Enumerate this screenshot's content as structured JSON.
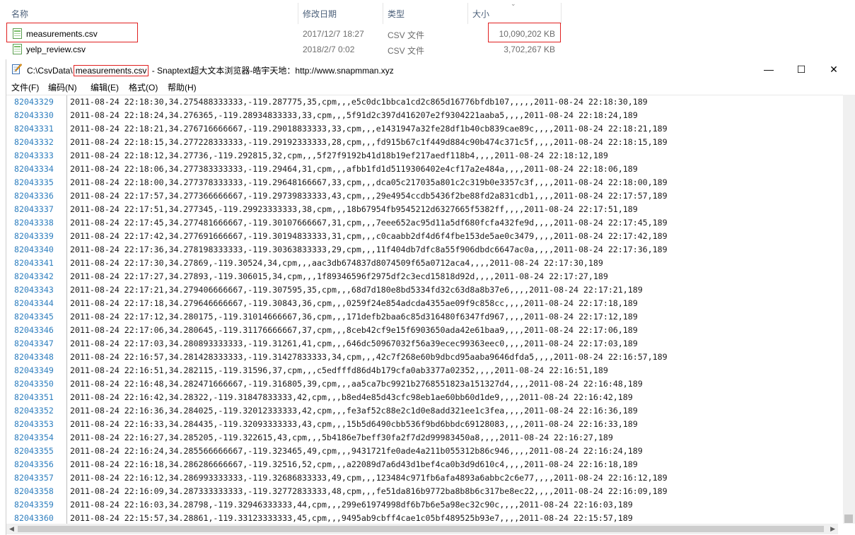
{
  "explorer": {
    "columns": {
      "name": "名称",
      "modified": "修改日期",
      "type": "类型",
      "size": "大小"
    },
    "files": [
      {
        "name": "measurements.csv",
        "modified": "2017/12/7 18:27",
        "type": "CSV 文件",
        "size": "10,090,202 KB"
      },
      {
        "name": "yelp_review.csv",
        "modified": "2018/2/7 0:02",
        "type": "CSV 文件",
        "size": "3,702,267 KB"
      }
    ]
  },
  "window": {
    "title_prefix": "C:\\CsvData\\",
    "title_file": "measurements.csv",
    "title_suffix": " - Snaptext超大文本浏览器-皓宇天地：http://www.snapmman.xyz",
    "buttons": {
      "minimize": "—",
      "maximize": "☐",
      "close": "✕"
    }
  },
  "menu": [
    "文件(F)",
    "编码(N)",
    "编辑(E)",
    "格式(O)",
    "帮助(H)"
  ],
  "lines": [
    {
      "n": "82043329",
      "t": "2011-08-24 22:18:30,34.275488333333,-119.287775,35,cpm,,,e5c0dc1bbca1cd2c865d16776bfdb107,,,,,2011-08-24 22:18:30,189"
    },
    {
      "n": "82043330",
      "t": "2011-08-24 22:18:24,34.276365,-119.28934833333,33,cpm,,,5f91d2c397d416207e2f9304221aaba5,,,,2011-08-24 22:18:24,189"
    },
    {
      "n": "82043331",
      "t": "2011-08-24 22:18:21,34.276716666667,-119.29018833333,33,cpm,,,e1431947a32fe28df1b40cb839cae89c,,,,2011-08-24 22:18:21,189"
    },
    {
      "n": "82043332",
      "t": "2011-08-24 22:18:15,34.277228333333,-119.29192333333,28,cpm,,,fd915b67c1f449d884c90b474c371c5f,,,,2011-08-24 22:18:15,189"
    },
    {
      "n": "82043333",
      "t": "2011-08-24 22:18:12,34.27736,-119.292815,32,cpm,,,5f27f9192b41d18b19ef217aedf118b4,,,,2011-08-24 22:18:12,189"
    },
    {
      "n": "82043334",
      "t": "2011-08-24 22:18:06,34.277383333333,-119.29464,31,cpm,,,afbb1fd1d5119306402e4cf17a2e484a,,,,2011-08-24 22:18:06,189"
    },
    {
      "n": "82043335",
      "t": "2011-08-24 22:18:00,34.277378333333,-119.29648166667,33,cpm,,,dca05c217035a801c2c319b0e3357c3f,,,,2011-08-24 22:18:00,189"
    },
    {
      "n": "82043336",
      "t": "2011-08-24 22:17:57,34.277366666667,-119.29739833333,43,cpm,,,29e4954ccdb5436f2be88fd2a831cdb1,,,,2011-08-24 22:17:57,189"
    },
    {
      "n": "82043337",
      "t": "2011-08-24 22:17:51,34.277345,-119.29923333333,38,cpm,,,18b67954fb9545212d6327665f5382ff,,,,2011-08-24 22:17:51,189"
    },
    {
      "n": "82043338",
      "t": "2011-08-24 22:17:45,34.277481666667,-119.30107666667,31,cpm,,,7eee652ac95d11a5df680fcfa432fe9d,,,,2011-08-24 22:17:45,189"
    },
    {
      "n": "82043339",
      "t": "2011-08-24 22:17:42,34.277691666667,-119.30194833333,31,cpm,,,c0caabb2df4d6f4fbe153de5ae0c3479,,,,2011-08-24 22:17:42,189"
    },
    {
      "n": "82043340",
      "t": "2011-08-24 22:17:36,34.278198333333,-119.30363833333,29,cpm,,,11f404db7dfc8a55f906dbdc6647ac0a,,,,2011-08-24 22:17:36,189"
    },
    {
      "n": "82043341",
      "t": "2011-08-24 22:17:30,34.27869,-119.30524,34,cpm,,,aac3db674837d8074509f65a0712aca4,,,,2011-08-24 22:17:30,189"
    },
    {
      "n": "82043342",
      "t": "2011-08-24 22:17:27,34.27893,-119.306015,34,cpm,,,1f89346596f2975df2c3ecd15818d92d,,,,2011-08-24 22:17:27,189"
    },
    {
      "n": "82043343",
      "t": "2011-08-24 22:17:21,34.279406666667,-119.307595,35,cpm,,,68d7d180e8bd5334fd32c63d8a8b37e6,,,,2011-08-24 22:17:21,189"
    },
    {
      "n": "82043344",
      "t": "2011-08-24 22:17:18,34.279646666667,-119.30843,36,cpm,,,0259f24e854adcda4355ae09f9c858cc,,,,2011-08-24 22:17:18,189"
    },
    {
      "n": "82043345",
      "t": "2011-08-24 22:17:12,34.280175,-119.31014666667,36,cpm,,,171defb2baa6c85d316480f6347fd967,,,,2011-08-24 22:17:12,189"
    },
    {
      "n": "82043346",
      "t": "2011-08-24 22:17:06,34.280645,-119.31176666667,37,cpm,,,8ceb42cf9e15f6903650ada42e61baa9,,,,2011-08-24 22:17:06,189"
    },
    {
      "n": "82043347",
      "t": "2011-08-24 22:17:03,34.280893333333,-119.31261,41,cpm,,,646dc50967032f56a39ecec99363eec0,,,,2011-08-24 22:17:03,189"
    },
    {
      "n": "82043348",
      "t": "2011-08-24 22:16:57,34.281428333333,-119.31427833333,34,cpm,,,42c7f268e60b9dbcd95aaba9646dfda5,,,,2011-08-24 22:16:57,189"
    },
    {
      "n": "82043349",
      "t": "2011-08-24 22:16:51,34.282115,-119.31596,37,cpm,,,c5edfffd86d4b179cfa0ab3377a02352,,,,2011-08-24 22:16:51,189"
    },
    {
      "n": "82043350",
      "t": "2011-08-24 22:16:48,34.282471666667,-119.316805,39,cpm,,,aa5ca7bc9921b2768551823a151327d4,,,,2011-08-24 22:16:48,189"
    },
    {
      "n": "82043351",
      "t": "2011-08-24 22:16:42,34.28322,-119.31847833333,42,cpm,,,b8ed4e85d43cfc98eb1ae60bb60d1de9,,,,2011-08-24 22:16:42,189"
    },
    {
      "n": "82043352",
      "t": "2011-08-24 22:16:36,34.284025,-119.32012333333,42,cpm,,,fe3af52c88e2c1d0e8add321ee1c3fea,,,,2011-08-24 22:16:36,189"
    },
    {
      "n": "82043353",
      "t": "2011-08-24 22:16:33,34.284435,-119.32093333333,43,cpm,,,15b5d6490cbb536f9bd6bbdc69128083,,,,2011-08-24 22:16:33,189"
    },
    {
      "n": "82043354",
      "t": "2011-08-24 22:16:27,34.285205,-119.322615,43,cpm,,,5b4186e7beff30fa2f7d2d99983450a8,,,,2011-08-24 22:16:27,189"
    },
    {
      "n": "82043355",
      "t": "2011-08-24 22:16:24,34.285566666667,-119.323465,49,cpm,,,9431721fe0ade4a211b055312b86c946,,,,2011-08-24 22:16:24,189"
    },
    {
      "n": "82043356",
      "t": "2011-08-24 22:16:18,34.286286666667,-119.32516,52,cpm,,,a22089d7a6d43d1bef4ca0b3d9d610c4,,,,2011-08-24 22:16:18,189"
    },
    {
      "n": "82043357",
      "t": "2011-08-24 22:16:12,34.286993333333,-119.32686833333,49,cpm,,,123484c971fb6afa4893a6abbc2c6e77,,,,2011-08-24 22:16:12,189"
    },
    {
      "n": "82043358",
      "t": "2011-08-24 22:16:09,34.287333333333,-119.32772833333,48,cpm,,,fe51da816b9772ba8b8b6c317be8ec22,,,,2011-08-24 22:16:09,189"
    },
    {
      "n": "82043359",
      "t": "2011-08-24 22:16:03,34.28798,-119.32946333333,44,cpm,,,299e61974998df6b7b6e5a98ec32c90c,,,,2011-08-24 22:16:03,189"
    },
    {
      "n": "82043360",
      "t": "2011-08-24 22:15:57,34.28861,-119.33123333333,45,cpm,,,9495ab9cbff4cae1c05bf489525b93e7,,,,2011-08-24 22:15:57,189"
    }
  ]
}
